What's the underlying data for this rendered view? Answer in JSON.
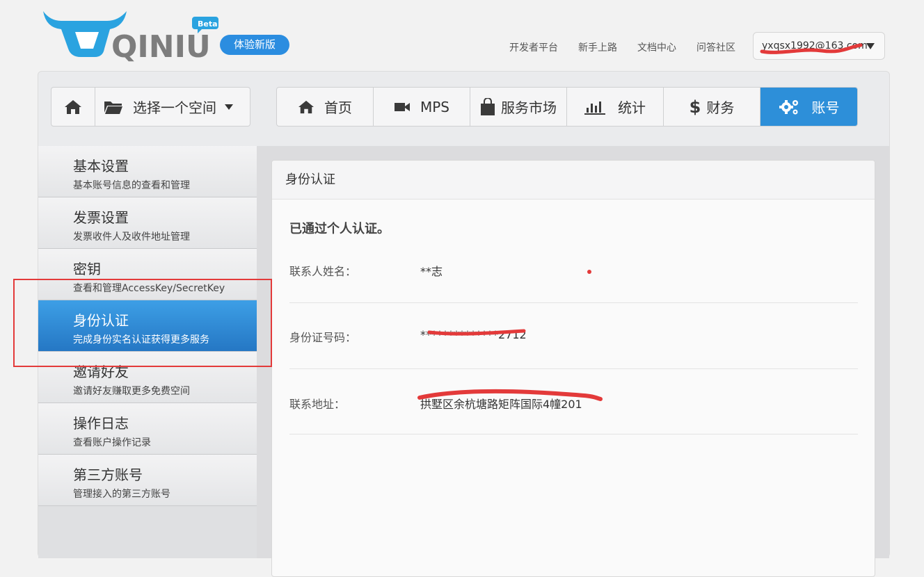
{
  "brand": {
    "logo_text": "QINIU",
    "beta_badge": "Beta",
    "try_new_label": "体验新版"
  },
  "top_links": [
    "开发者平台",
    "新手上路",
    "文档中心",
    "问答社区"
  ],
  "user": {
    "email": "yxqsx1992@163.com"
  },
  "space_selector": {
    "label": "选择一个空间"
  },
  "nav": [
    {
      "label": "首页",
      "icon": "home-icon"
    },
    {
      "label": "MPS",
      "icon": "video-camera-icon"
    },
    {
      "label": "服务市场",
      "icon": "shopping-bag-icon"
    },
    {
      "label": "统计",
      "icon": "bar-chart-icon"
    },
    {
      "label": "财务",
      "icon": "dollar-icon"
    },
    {
      "label": "账号",
      "icon": "gears-icon",
      "active": true
    }
  ],
  "sidebar": {
    "items": [
      {
        "title": "基本设置",
        "subtitle": "基本账号信息的查看和管理"
      },
      {
        "title": "发票设置",
        "subtitle": "发票收件人及收件地址管理"
      },
      {
        "title": "密钥",
        "subtitle": "查看和管理AccessKey/SecretKey"
      },
      {
        "title": "身份认证",
        "subtitle": "完成身份实名认证获得更多服务",
        "active": true
      },
      {
        "title": "邀请好友",
        "subtitle": "邀请好友赚取更多免费空间"
      },
      {
        "title": "操作日志",
        "subtitle": "查看账户操作记录"
      },
      {
        "title": "第三方账号",
        "subtitle": "管理接入的第三方账号"
      }
    ]
  },
  "identity": {
    "panel_title": "身份认证",
    "status": "已通过个人认证。",
    "fields": [
      {
        "label": "联系人姓名：",
        "value": "**志"
      },
      {
        "label": "身份证号码：",
        "value": "**************2712"
      },
      {
        "label": "联系地址：",
        "value": "拱墅区余杭塘路矩阵国际4幢201"
      }
    ]
  },
  "colors": {
    "accent": "#2d8fd9",
    "annotation_red": "#e33a3a"
  }
}
